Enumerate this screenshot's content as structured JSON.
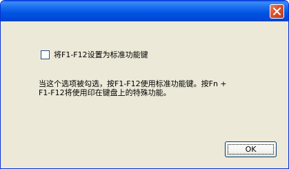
{
  "window": {
    "title": ""
  },
  "checkbox": {
    "label": "将F1-F12设置为标准功能键",
    "checked": false
  },
  "description": {
    "line1": "当这个选项被勾选，按F1-F12使用标准功能键。按Fn +",
    "line2": "F1-F12将使用印在键盘上的特殊功能。"
  },
  "buttons": {
    "ok_label": "OK"
  },
  "icons": {
    "close": "close-icon"
  },
  "colors": {
    "titlebar": "#0054e3",
    "close_button": "#d9512c",
    "dialog_background": "#ece9d8"
  }
}
